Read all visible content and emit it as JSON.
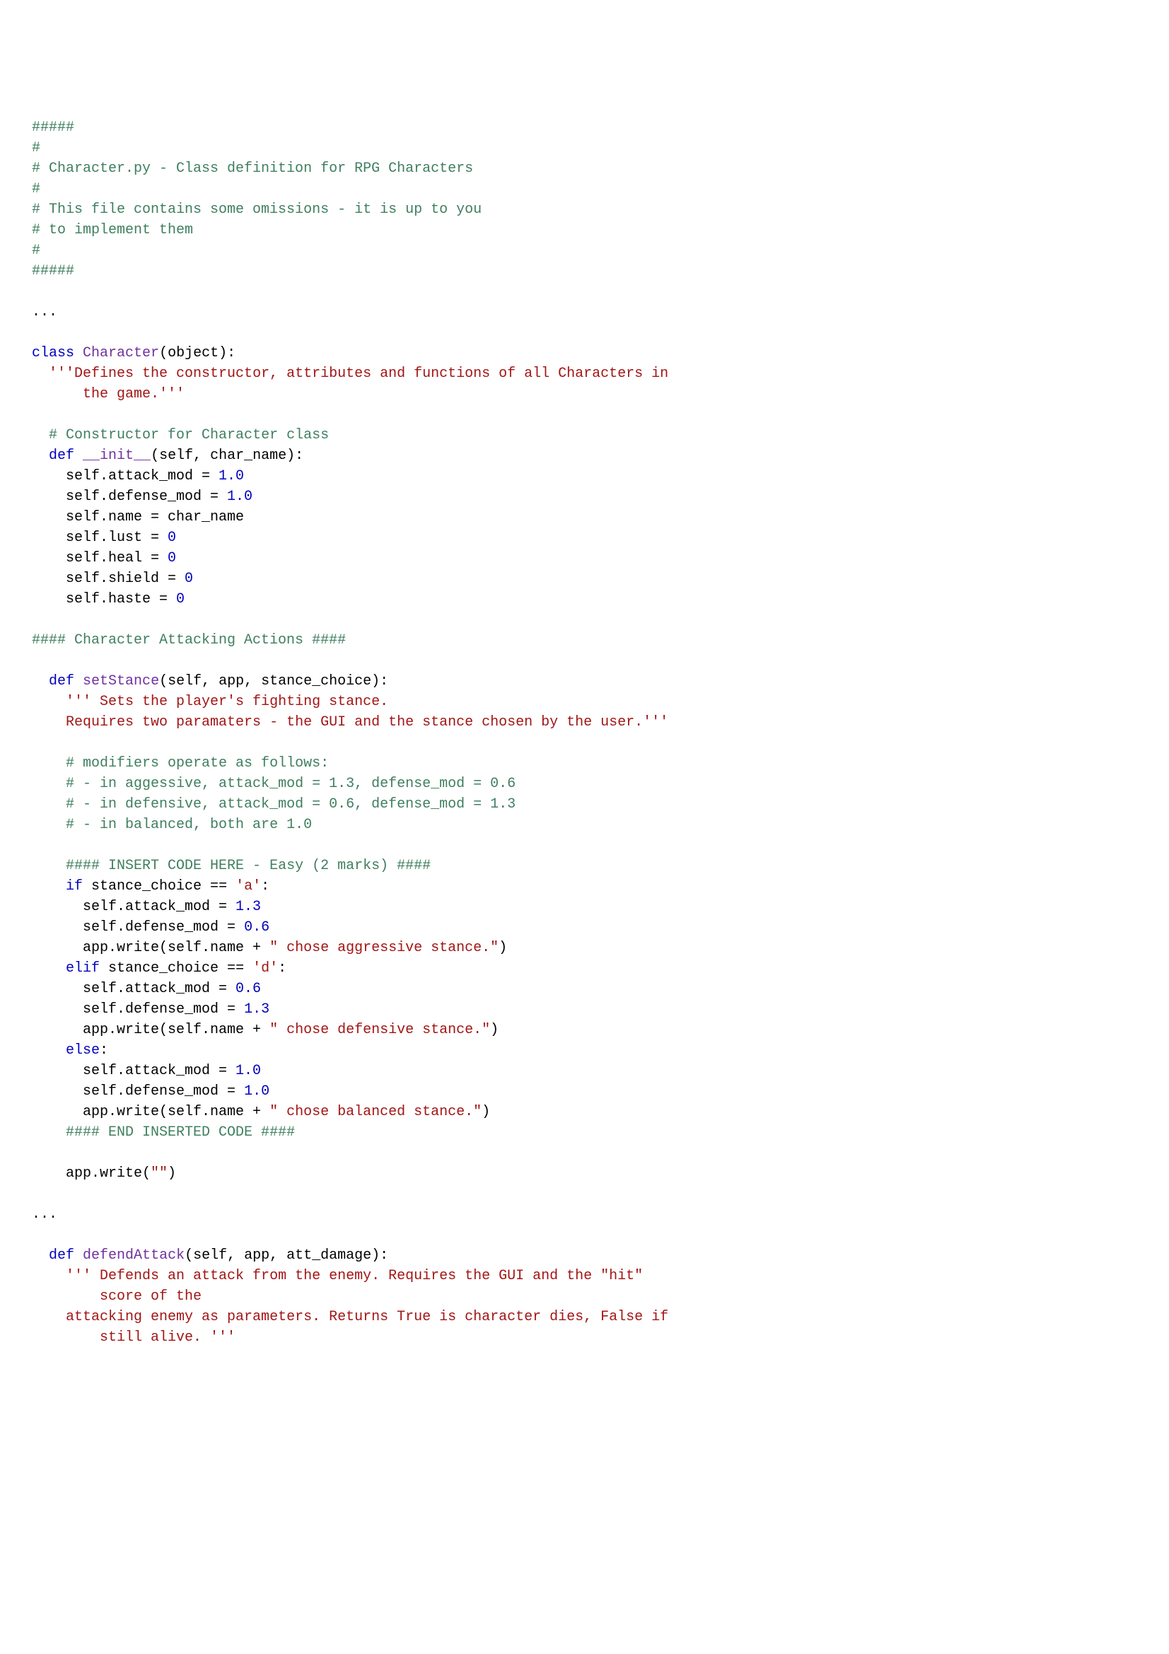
{
  "code_lines": [
    [
      {
        "cls": "c",
        "t": "#####"
      }
    ],
    [
      {
        "cls": "c",
        "t": "#"
      }
    ],
    [
      {
        "cls": "c",
        "t": "# Character.py - Class definition for RPG Characters"
      }
    ],
    [
      {
        "cls": "c",
        "t": "#"
      }
    ],
    [
      {
        "cls": "c",
        "t": "# This file contains some omissions - it is up to you"
      }
    ],
    [
      {
        "cls": "c",
        "t": "# to implement them"
      }
    ],
    [
      {
        "cls": "c",
        "t": "#"
      }
    ],
    [
      {
        "cls": "c",
        "t": "#####"
      }
    ],
    [],
    [
      {
        "cls": "p",
        "t": "..."
      }
    ],
    [],
    [
      {
        "cls": "k",
        "t": "class"
      },
      {
        "cls": "p",
        "t": " "
      },
      {
        "cls": "cl",
        "t": "Character"
      },
      {
        "cls": "p",
        "t": "(object):"
      }
    ],
    [
      {
        "cls": "p",
        "t": "  "
      },
      {
        "cls": "s",
        "t": "'''Defines the constructor, attributes and functions of all Characters in"
      }
    ],
    [
      {
        "cls": "p",
        "t": "      "
      },
      {
        "cls": "s",
        "t": "the game.'''"
      }
    ],
    [],
    [
      {
        "cls": "p",
        "t": "  "
      },
      {
        "cls": "c",
        "t": "# Constructor for Character class"
      }
    ],
    [
      {
        "cls": "p",
        "t": "  "
      },
      {
        "cls": "k",
        "t": "def"
      },
      {
        "cls": "p",
        "t": " "
      },
      {
        "cls": "cl",
        "t": "__init__"
      },
      {
        "cls": "p",
        "t": "(self, char_name):"
      }
    ],
    [
      {
        "cls": "p",
        "t": "    self.attack_mod = "
      },
      {
        "cls": "n",
        "t": "1.0"
      }
    ],
    [
      {
        "cls": "p",
        "t": "    self.defense_mod = "
      },
      {
        "cls": "n",
        "t": "1.0"
      }
    ],
    [
      {
        "cls": "p",
        "t": "    self.name = char_name"
      }
    ],
    [
      {
        "cls": "p",
        "t": "    self.lust = "
      },
      {
        "cls": "n",
        "t": "0"
      }
    ],
    [
      {
        "cls": "p",
        "t": "    self.heal = "
      },
      {
        "cls": "n",
        "t": "0"
      }
    ],
    [
      {
        "cls": "p",
        "t": "    self.shield = "
      },
      {
        "cls": "n",
        "t": "0"
      }
    ],
    [
      {
        "cls": "p",
        "t": "    self.haste = "
      },
      {
        "cls": "n",
        "t": "0"
      }
    ],
    [],
    [
      {
        "cls": "c",
        "t": "#### Character Attacking Actions ####"
      }
    ],
    [],
    [
      {
        "cls": "p",
        "t": "  "
      },
      {
        "cls": "k",
        "t": "def"
      },
      {
        "cls": "p",
        "t": " "
      },
      {
        "cls": "cl",
        "t": "setStance"
      },
      {
        "cls": "p",
        "t": "(self, app, stance_choice):"
      }
    ],
    [
      {
        "cls": "p",
        "t": "    "
      },
      {
        "cls": "s",
        "t": "''' Sets the player's fighting stance."
      }
    ],
    [
      {
        "cls": "p",
        "t": "    "
      },
      {
        "cls": "s",
        "t": "Requires two paramaters - the GUI and the stance chosen by the user.'''"
      }
    ],
    [],
    [
      {
        "cls": "p",
        "t": "    "
      },
      {
        "cls": "c",
        "t": "# modifiers operate as follows:"
      }
    ],
    [
      {
        "cls": "p",
        "t": "    "
      },
      {
        "cls": "c",
        "t": "# - in aggessive, attack_mod = 1.3, defense_mod = 0.6"
      }
    ],
    [
      {
        "cls": "p",
        "t": "    "
      },
      {
        "cls": "c",
        "t": "# - in defensive, attack_mod = 0.6, defense_mod = 1.3"
      }
    ],
    [
      {
        "cls": "p",
        "t": "    "
      },
      {
        "cls": "c",
        "t": "# - in balanced, both are 1.0"
      }
    ],
    [],
    [
      {
        "cls": "p",
        "t": "    "
      },
      {
        "cls": "c",
        "t": "#### INSERT CODE HERE - Easy (2 marks) ####"
      }
    ],
    [
      {
        "cls": "p",
        "t": "    "
      },
      {
        "cls": "k",
        "t": "if"
      },
      {
        "cls": "p",
        "t": " stance_choice == "
      },
      {
        "cls": "s",
        "t": "'a'"
      },
      {
        "cls": "p",
        "t": ":"
      }
    ],
    [
      {
        "cls": "p",
        "t": "      self.attack_mod = "
      },
      {
        "cls": "n",
        "t": "1.3"
      }
    ],
    [
      {
        "cls": "p",
        "t": "      self.defense_mod = "
      },
      {
        "cls": "n",
        "t": "0.6"
      }
    ],
    [
      {
        "cls": "p",
        "t": "      app.write(self.name + "
      },
      {
        "cls": "s",
        "t": "\" chose aggressive stance.\""
      },
      {
        "cls": "p",
        "t": ")"
      }
    ],
    [
      {
        "cls": "p",
        "t": "    "
      },
      {
        "cls": "k",
        "t": "elif"
      },
      {
        "cls": "p",
        "t": " stance_choice == "
      },
      {
        "cls": "s",
        "t": "'d'"
      },
      {
        "cls": "p",
        "t": ":"
      }
    ],
    [
      {
        "cls": "p",
        "t": "      self.attack_mod = "
      },
      {
        "cls": "n",
        "t": "0.6"
      }
    ],
    [
      {
        "cls": "p",
        "t": "      self.defense_mod = "
      },
      {
        "cls": "n",
        "t": "1.3"
      }
    ],
    [
      {
        "cls": "p",
        "t": "      app.write(self.name + "
      },
      {
        "cls": "s",
        "t": "\" chose defensive stance.\""
      },
      {
        "cls": "p",
        "t": ")"
      }
    ],
    [
      {
        "cls": "p",
        "t": "    "
      },
      {
        "cls": "k",
        "t": "else"
      },
      {
        "cls": "p",
        "t": ":"
      }
    ],
    [
      {
        "cls": "p",
        "t": "      self.attack_mod = "
      },
      {
        "cls": "n",
        "t": "1.0"
      }
    ],
    [
      {
        "cls": "p",
        "t": "      self.defense_mod = "
      },
      {
        "cls": "n",
        "t": "1.0"
      }
    ],
    [
      {
        "cls": "p",
        "t": "      app.write(self.name + "
      },
      {
        "cls": "s",
        "t": "\" chose balanced stance.\""
      },
      {
        "cls": "p",
        "t": ")"
      }
    ],
    [
      {
        "cls": "p",
        "t": "    "
      },
      {
        "cls": "c",
        "t": "#### END INSERTED CODE ####"
      }
    ],
    [],
    [
      {
        "cls": "p",
        "t": "    app.write("
      },
      {
        "cls": "s",
        "t": "\"\""
      },
      {
        "cls": "p",
        "t": ")"
      }
    ],
    [],
    [
      {
        "cls": "p",
        "t": "..."
      }
    ],
    [],
    [
      {
        "cls": "p",
        "t": "  "
      },
      {
        "cls": "k",
        "t": "def"
      },
      {
        "cls": "p",
        "t": " "
      },
      {
        "cls": "cl",
        "t": "defendAttack"
      },
      {
        "cls": "p",
        "t": "(self, app, att_damage):"
      }
    ],
    [
      {
        "cls": "p",
        "t": "    "
      },
      {
        "cls": "s",
        "t": "''' Defends an attack from the enemy. Requires the GUI and the \"hit\""
      }
    ],
    [
      {
        "cls": "p",
        "t": "        "
      },
      {
        "cls": "s",
        "t": "score of the"
      }
    ],
    [
      {
        "cls": "p",
        "t": "    "
      },
      {
        "cls": "s",
        "t": "attacking enemy as parameters. Returns True is character dies, False if"
      }
    ],
    [
      {
        "cls": "p",
        "t": "        "
      },
      {
        "cls": "s",
        "t": "still alive. '''"
      }
    ]
  ]
}
